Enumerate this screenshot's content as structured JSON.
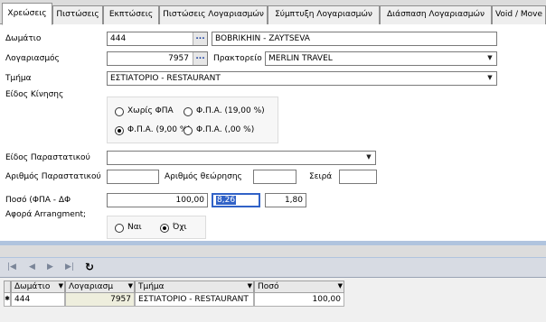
{
  "tabs": [
    {
      "label": "Χρεώσεις",
      "active": true
    },
    {
      "label": "Πιστώσεις"
    },
    {
      "label": "Εκπτώσεις"
    },
    {
      "label": "Πιστώσεις Λογαριασμών"
    },
    {
      "label": "Σύμπτυξη Λογαριασμών"
    },
    {
      "label": "Διάσπαση Λογαριασμών"
    },
    {
      "label": "Void / Move"
    }
  ],
  "form": {
    "room_label": "Δωμάτιο",
    "room_value": "444",
    "guest_name": "BOBRIKHIN - ZAYTSEVA",
    "account_label": "Λογαριασμός",
    "account_value": "7957",
    "agency_label": "Πρακτορείο",
    "agency_value": "MERLIN TRAVEL",
    "department_label": "Τμήμα",
    "department_value": "ΕΣΤΙΑΤΟΡΙΟ - RESTAURANT",
    "movement_type_label": "Είδος Κίνησης",
    "vat_options": [
      {
        "label": "Χωρίς ΦΠΑ",
        "selected": false
      },
      {
        "label": "Φ.Π.Α. (19,00 %)",
        "selected": false
      },
      {
        "label": "Φ.Π.Α. (9,00 %)",
        "selected": true
      },
      {
        "label": "Φ.Π.Α. (,00 %)",
        "selected": false
      }
    ],
    "document_type_label": "Είδος Παραστατικού",
    "document_type_value": "",
    "document_number_label": "Αριθμός Παραστατικού",
    "document_number_value": "",
    "approval_number_label": "Αριθμός θεώρησης",
    "approval_number_value": "",
    "series_label": "Σειρά",
    "series_value": "",
    "amount_label": "Ποσό (ΦΠΑ - ΔΦ",
    "amount_value": "100,00",
    "vat_amount_value": "8,26",
    "tax_amount_value": "1,80",
    "arrangement_label": "Αφορά Arrangment;",
    "arrangement_options": [
      {
        "label": "Ναι",
        "selected": false
      },
      {
        "label": "Όχι",
        "selected": true
      }
    ]
  },
  "icons": {
    "ellipsis": "...",
    "dropdown": "▼",
    "first": "|◀",
    "prev": "◀",
    "next": "▶",
    "last": "▶|",
    "refresh": "↻",
    "filter": "▼",
    "row_marker": "✱"
  },
  "grid": {
    "columns": [
      "Δωμάτιο",
      "Λογαριασμ",
      "Τμήμα",
      "Ποσό"
    ],
    "rows": [
      [
        "444",
        "7957",
        "ΕΣΤΙΑΤΟΡΙΟ - RESTAURANT",
        "100,00"
      ]
    ]
  },
  "colors": {
    "selection": "#3162c7",
    "account_cell_bg": "#eeeedd"
  }
}
